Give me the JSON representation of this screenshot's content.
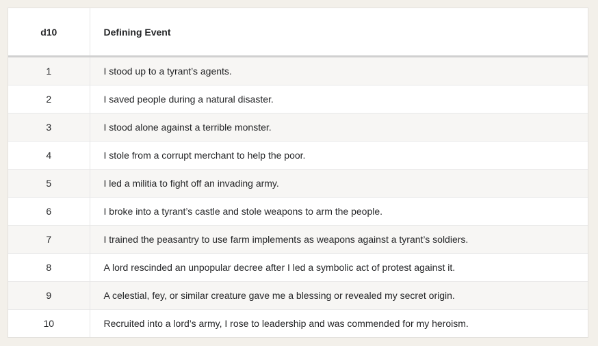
{
  "table": {
    "headers": [
      "d10",
      "Defining Event"
    ],
    "rows": [
      {
        "roll": "1",
        "event": "I stood up to a tyrant’s agents."
      },
      {
        "roll": "2",
        "event": "I saved people during a natural disaster."
      },
      {
        "roll": "3",
        "event": "I stood alone against a terrible monster."
      },
      {
        "roll": "4",
        "event": "I stole from a corrupt merchant to help the poor."
      },
      {
        "roll": "5",
        "event": "I led a militia to fight off an invading army."
      },
      {
        "roll": "6",
        "event": "I broke into a tyrant’s castle and stole weapons to arm the people."
      },
      {
        "roll": "7",
        "event": "I trained the peasantry to use farm implements as weapons against a tyrant’s soldiers."
      },
      {
        "roll": "8",
        "event": "A lord rescinded an unpopular decree after I led a symbolic act of protest against it."
      },
      {
        "roll": "9",
        "event": "A celestial, fey, or similar creature gave me a blessing or revealed my secret origin."
      },
      {
        "roll": "10",
        "event": "Recruited into a lord’s army, I rose to leadership and was commended for my heroism."
      }
    ]
  }
}
